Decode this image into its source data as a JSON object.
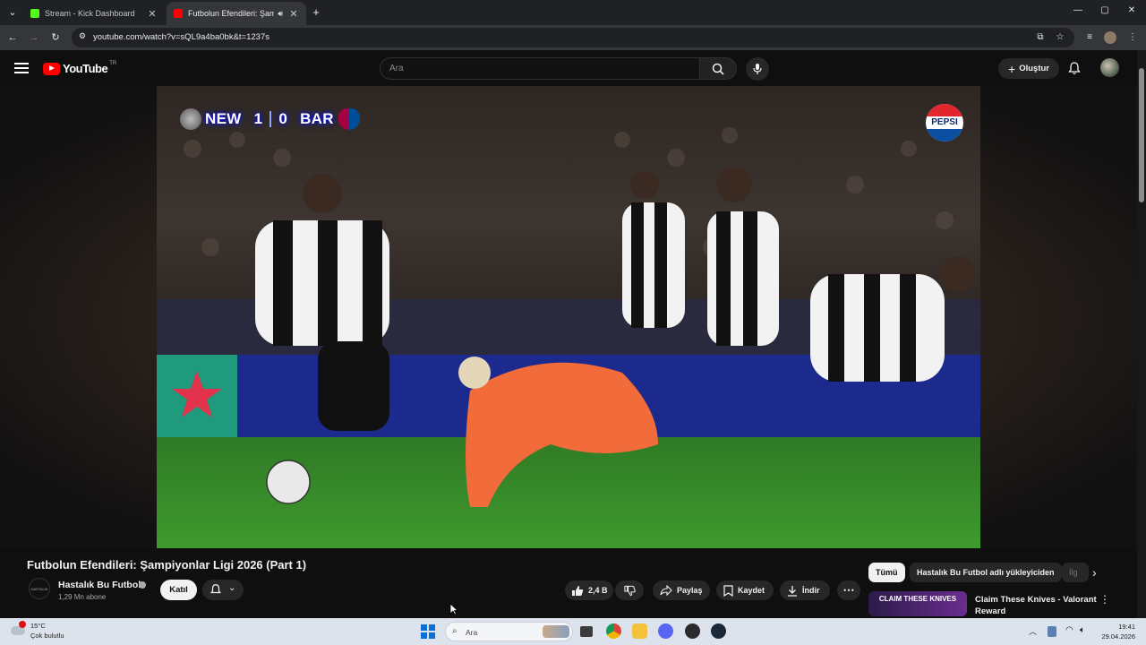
{
  "browser": {
    "tabs": [
      {
        "title": "Stream - Kick Dashboard",
        "favicon_color": "#53fc18",
        "active": false
      },
      {
        "title": "Futbolun Efendileri: Şampiy",
        "favicon_color": "#ff0000",
        "active": true
      }
    ],
    "url": "youtube.com/watch?v=sQL9a4ba0bk&t=1237s"
  },
  "youtube": {
    "logo_text": "YouTube",
    "country_code": "TR",
    "search_placeholder": "Ara",
    "create_label": "Oluştur"
  },
  "player": {
    "scorebug": {
      "home": "NEW",
      "home_score": "1",
      "away_score": "0",
      "away": "BAR"
    },
    "sponsor": "PEPSI"
  },
  "video": {
    "title": "Futbolun Efendileri: Şampiyonlar Ligi 2026 (Part 1)",
    "channel": {
      "name": "Hastalık Bu Futbol",
      "subscribers": "1,29 Mn abone",
      "avatar_text": "HASTALIK"
    },
    "join_label": "Katıl",
    "likes": "2,4 B",
    "share_label": "Paylaş",
    "save_label": "Kaydet",
    "download_label": "İndir"
  },
  "sidebar": {
    "chips": [
      "Tümü",
      "Hastalık Bu Futbol adlı yükleyiciden",
      "İlg"
    ],
    "recommendation": {
      "thumbnail_text": "CLAIM THESE KNIVES",
      "title": "Claim These Knives - Valorant Reward"
    }
  },
  "taskbar": {
    "weather": {
      "temp": "15°C",
      "desc": "Çok bulutlu"
    },
    "search_placeholder": "Ara",
    "time": "19:41",
    "date": "29.04.2026"
  }
}
